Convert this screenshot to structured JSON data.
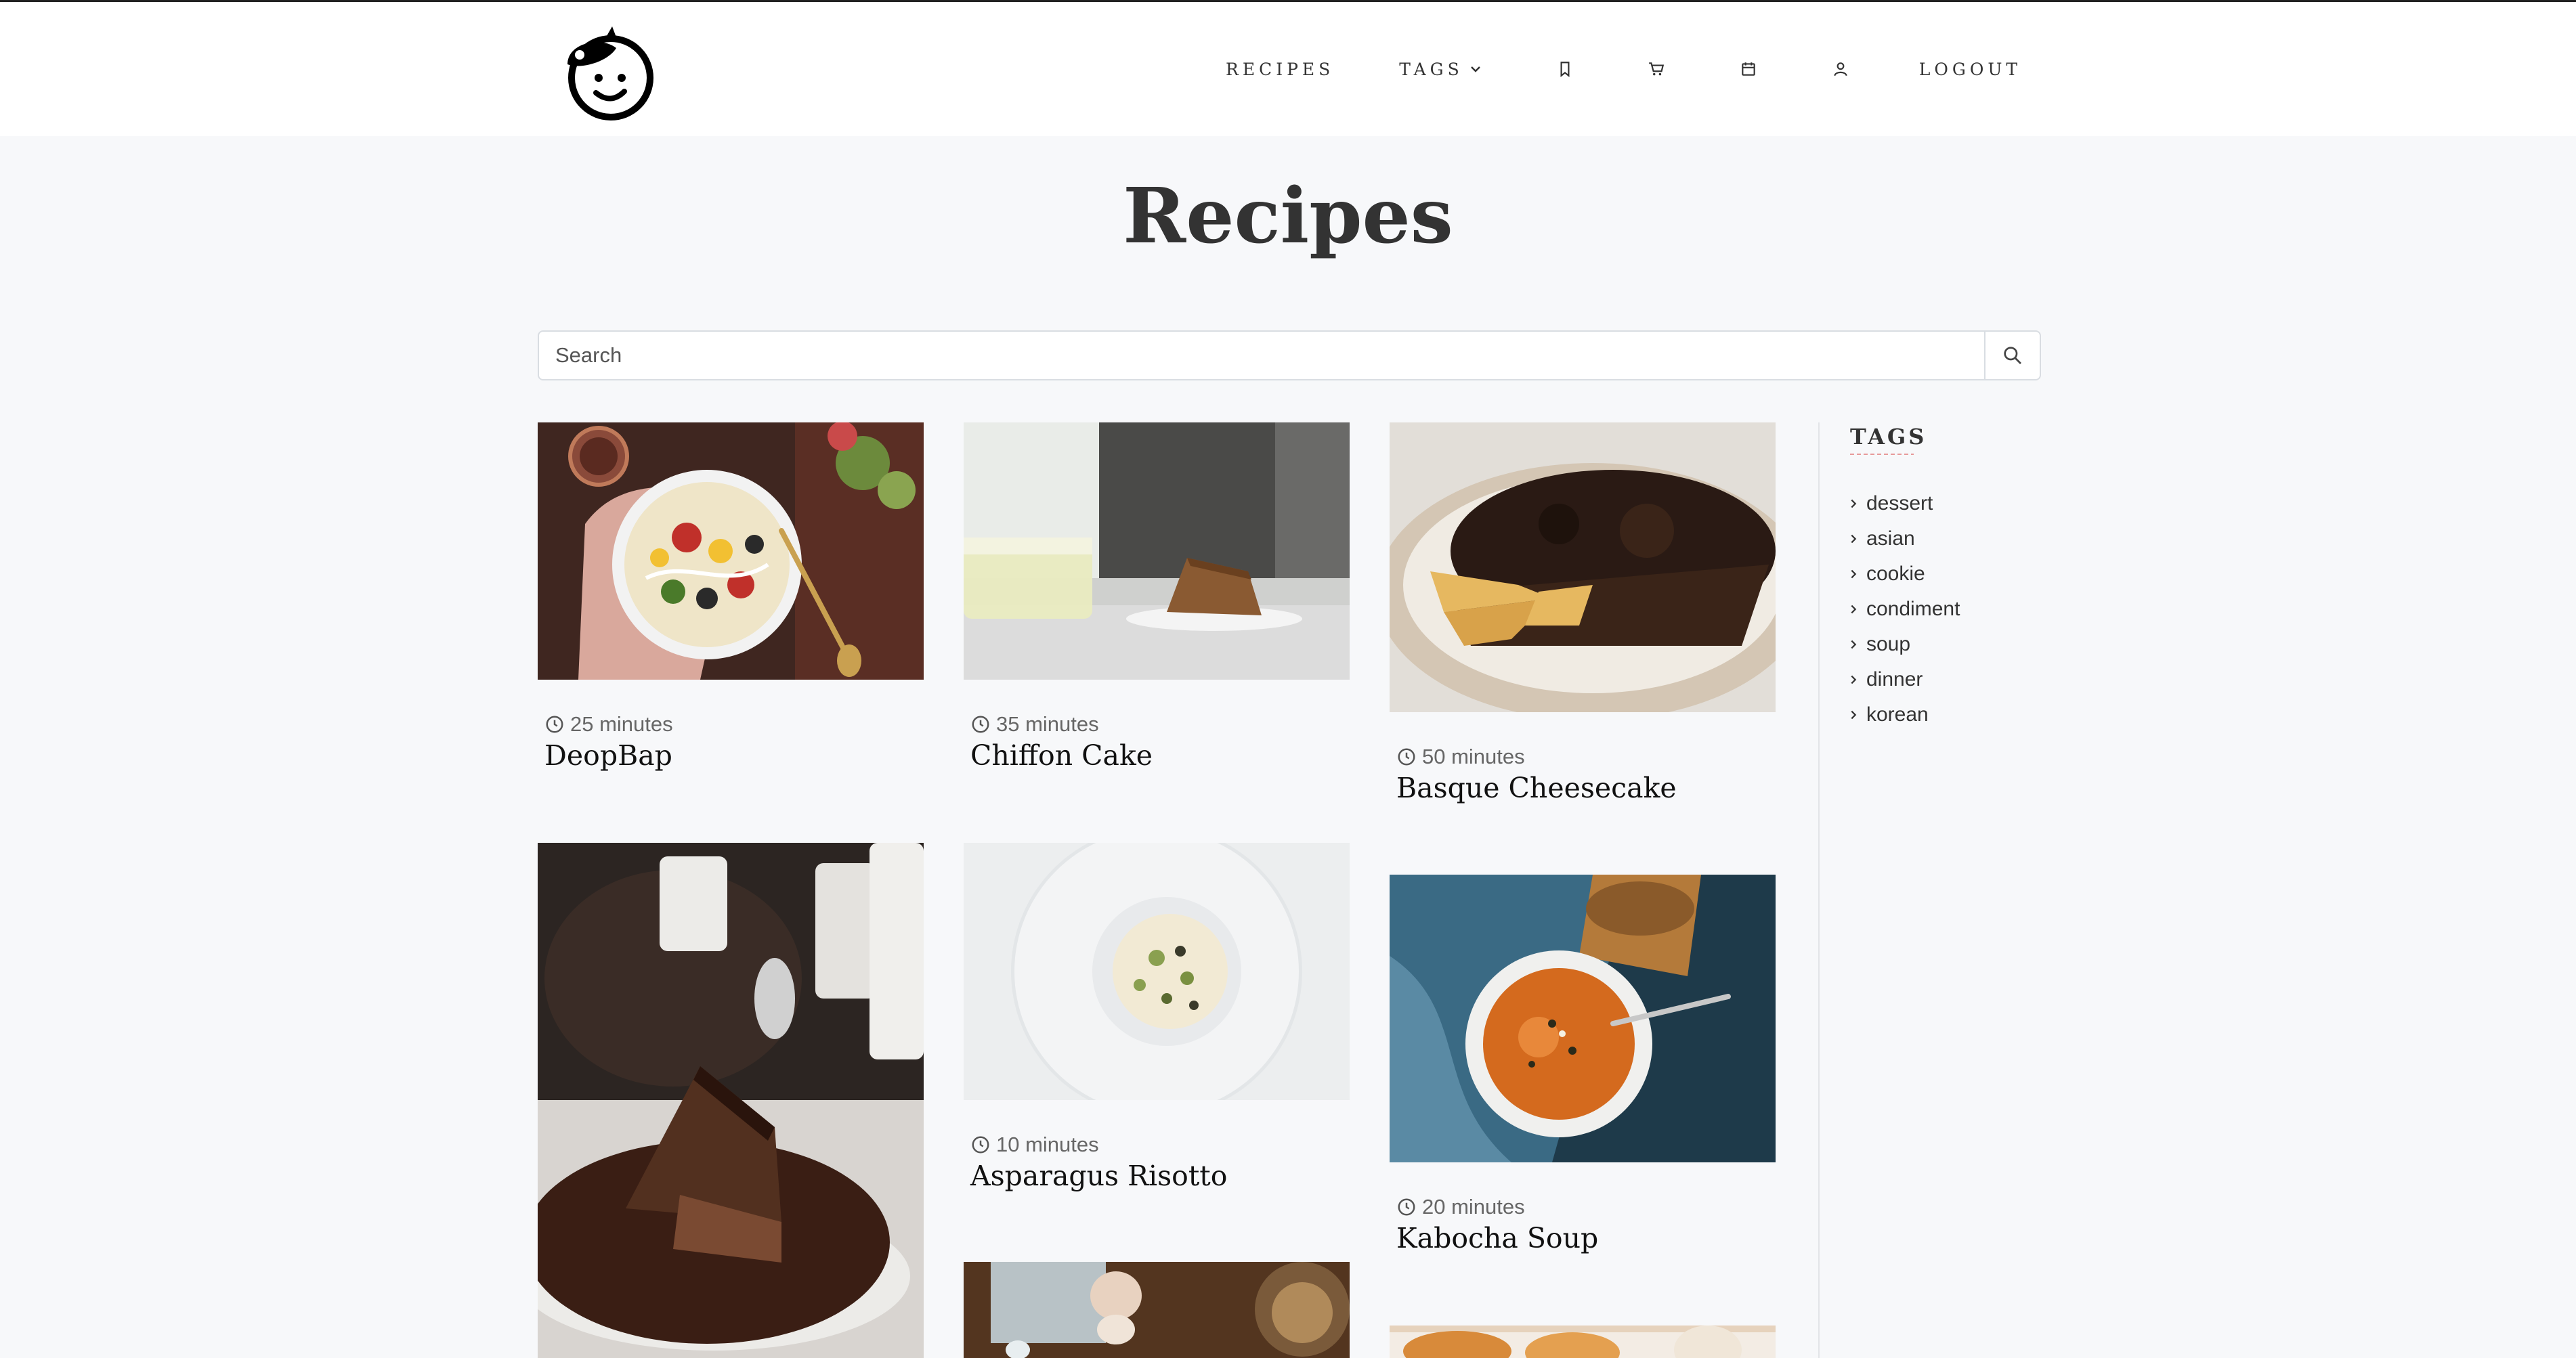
{
  "nav": {
    "recipes": "RECIPES",
    "tags": "TAGS",
    "logout": "LOGOUT",
    "icons": [
      "bookmark-icon",
      "cart-icon",
      "calendar-icon",
      "user-icon"
    ]
  },
  "page": {
    "title": "Recipes"
  },
  "search": {
    "placeholder": "Search"
  },
  "recipes": [
    {
      "time": "25 minutes",
      "title": "DeopBap"
    },
    {
      "time": "35 minutes",
      "title": "Chiffon Cake"
    },
    {
      "time": "50 minutes",
      "title": "Basque Cheesecake"
    },
    {
      "time": "",
      "title": ""
    },
    {
      "time": "10 minutes",
      "title": "Asparagus Risotto"
    },
    {
      "time": "20 minutes",
      "title": "Kabocha Soup"
    }
  ],
  "sidebar": {
    "heading": "TAGS",
    "tags": [
      "dessert",
      "asian",
      "cookie",
      "condiment",
      "soup",
      "dinner",
      "korean"
    ]
  },
  "colors": {
    "background": "#f7f8fa",
    "header": "#ffffff",
    "text": "#222222"
  }
}
